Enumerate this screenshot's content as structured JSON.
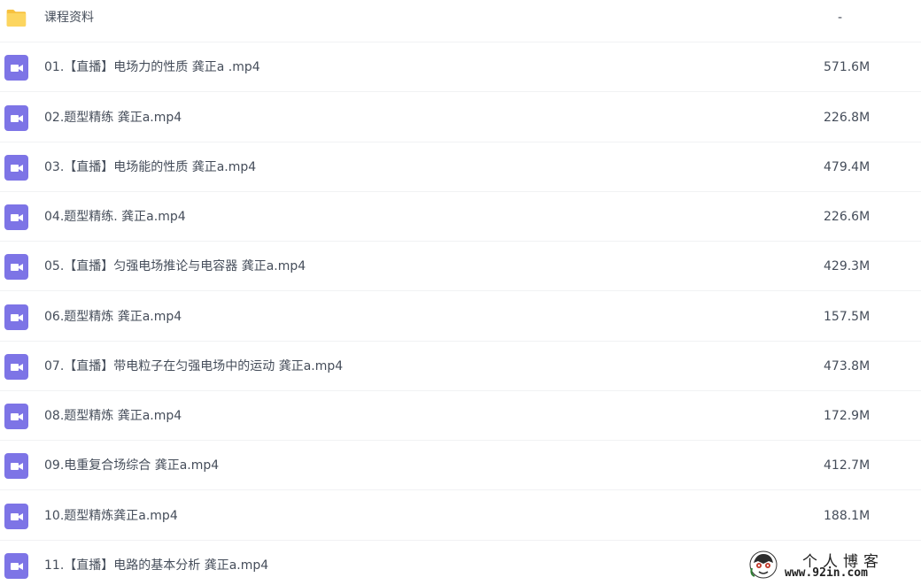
{
  "file_list": {
    "folder": {
      "name": "课程资料",
      "size": "-",
      "icon": "folder-icon"
    },
    "files": [
      {
        "name": "01.【直播】电场力的性质 龚正a .mp4",
        "size": "571.6M",
        "icon": "video-icon"
      },
      {
        "name": "02.题型精练 龚正a.mp4",
        "size": "226.8M",
        "icon": "video-icon"
      },
      {
        "name": "03.【直播】电场能的性质 龚正a.mp4",
        "size": "479.4M",
        "icon": "video-icon"
      },
      {
        "name": "04.题型精练. 龚正a.mp4",
        "size": "226.6M",
        "icon": "video-icon"
      },
      {
        "name": "05.【直播】匀强电场推论与电容器 龚正a.mp4",
        "size": "429.3M",
        "icon": "video-icon"
      },
      {
        "name": "06.题型精炼 龚正a.mp4",
        "size": "157.5M",
        "icon": "video-icon"
      },
      {
        "name": "07.【直播】带电粒子在匀强电场中的运动 龚正a.mp4",
        "size": "473.8M",
        "icon": "video-icon"
      },
      {
        "name": "08.题型精炼 龚正a.mp4",
        "size": "172.9M",
        "icon": "video-icon"
      },
      {
        "name": "09.电重复合场综合 龚正a.mp4",
        "size": "412.7M",
        "icon": "video-icon"
      },
      {
        "name": "10.题型精炼龚正a.mp4",
        "size": "188.1M",
        "icon": "video-icon"
      },
      {
        "name": "11.【直播】电路的基本分析 龚正a.mp4",
        "size": "",
        "icon": "video-icon"
      }
    ]
  },
  "watermark": {
    "title": "个人博客",
    "url": "www.92in.com"
  },
  "colors": {
    "video_icon": "#7d74e6",
    "folder_icon": "#fcd55f",
    "text": "#454d5a",
    "divider": "#f1f2f4"
  }
}
